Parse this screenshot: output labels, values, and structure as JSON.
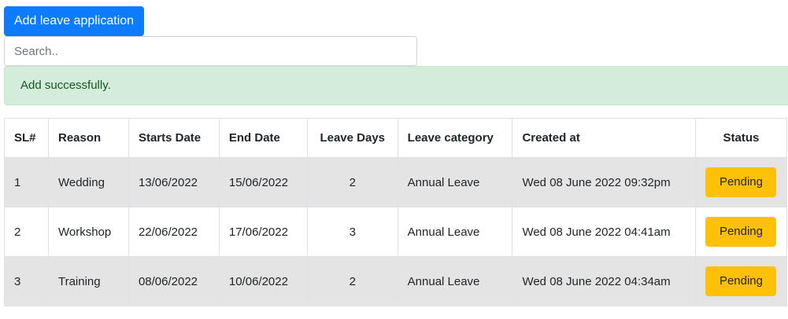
{
  "toolbar": {
    "add_label": "Add leave application",
    "accent_color": "#0d7bfd"
  },
  "search": {
    "placeholder": "Search..",
    "value": ""
  },
  "alert": {
    "message": "Add successfully.",
    "color": "#d4edda"
  },
  "table": {
    "headers": [
      "SL#",
      "Reason",
      "Starts Date",
      "End Date",
      "Leave Days",
      "Leave category",
      "Created at",
      "Status"
    ],
    "rows": [
      {
        "sl": "1",
        "reason": "Wedding",
        "start": "13/06/2022",
        "end": "15/06/2022",
        "days": "2",
        "category": "Annual Leave",
        "created": "Wed 08 June 2022 09:32pm",
        "status": "Pending"
      },
      {
        "sl": "2",
        "reason": "Workshop",
        "start": "22/06/2022",
        "end": "17/06/2022",
        "days": "3",
        "category": "Annual Leave",
        "created": "Wed 08 June 2022 04:41am",
        "status": "Pending"
      },
      {
        "sl": "3",
        "reason": "Training",
        "start": "08/06/2022",
        "end": "10/06/2022",
        "days": "2",
        "category": "Annual Leave",
        "created": "Wed 08 June 2022 04:34am",
        "status": "Pending"
      }
    ],
    "status_color": "#ffc107"
  }
}
